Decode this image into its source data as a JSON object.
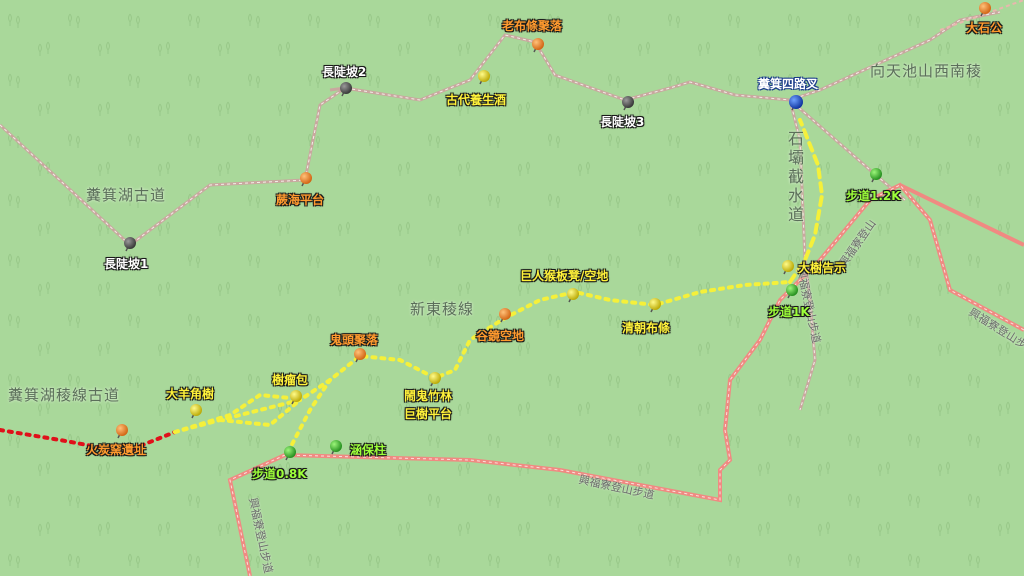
{
  "map": {
    "colors": {
      "background": "#a9d89a",
      "trail_track": "#d8a8a0",
      "highlight_route": "#f5f03a",
      "approach_route": "#e0101a",
      "highlight_trail": "#f39a8e"
    },
    "areas": {
      "jiqihu_ancient": "糞箕湖古道",
      "xindong_ridge": "新東稜線",
      "jiqihu_ridge_ancient": "糞箕湖稜線古道",
      "xiangtianchi_ridge": "向天池山西南稜",
      "shiba_jieshui": "石壩截水道"
    },
    "trails": {
      "xingfuliao_a": "興福寮登山步道",
      "xingfuliao_b": "興福寮登山步道",
      "xingfuliao_c": "興福寮登山步道",
      "xingfuliao_d": "興福寮登山",
      "xingfuliao_e": "興福寮登山步道"
    },
    "waypoints": {
      "laobutiao": {
        "label": "老布條聚落",
        "color": "orange"
      },
      "dashigong": {
        "label": "大石公",
        "color": "orange"
      },
      "changdoupo2": {
        "label": "長陡坡2",
        "color": "white"
      },
      "gudai_yangsheng": {
        "label": "古代養生酒",
        "color": "yellow"
      },
      "changdoupo3": {
        "label": "長陡坡3",
        "color": "white"
      },
      "jiqi_sirouxx": {
        "label": "糞箕四路叉",
        "color": "blue"
      },
      "weihai_pingtai": {
        "label": "蕨海平台",
        "color": "orange"
      },
      "changdoupo1": {
        "label": "長陡坡1",
        "color": "white"
      },
      "budao_1_2k": {
        "label": "步道1.2K",
        "color": "green"
      },
      "dashu_gaoshi": {
        "label": "大樹告示",
        "color": "yellow"
      },
      "juren_houban": {
        "label": "巨人猴板凳/空地",
        "color": "yellow"
      },
      "budao_1k": {
        "label": "步道1K",
        "color": "green"
      },
      "qingchao_butiao": {
        "label": "清朝布條",
        "color": "yellow"
      },
      "gujing_kongdi": {
        "label": "谷鏡空地",
        "color": "orange"
      },
      "guitou_juluo": {
        "label": "鬼頭聚落",
        "color": "orange"
      },
      "shuliu_bao": {
        "label": "樹瘤包",
        "color": "yellow"
      },
      "dayang_jiaoshu": {
        "label": "大羊角樹",
        "color": "yellow"
      },
      "naogui_zhulin": {
        "label": "鬧鬼竹林",
        "color": "yellow"
      },
      "jushu_pingtai": {
        "label": "巨樹平台",
        "color": "yellow"
      },
      "huotan_yizhi": {
        "label": "火炭窯遺址",
        "color": "orange"
      },
      "budao_0_8k": {
        "label": "步道0.8K",
        "color": "green"
      },
      "hanbaozhu": {
        "label": "涵保柱",
        "color": "green"
      }
    }
  }
}
